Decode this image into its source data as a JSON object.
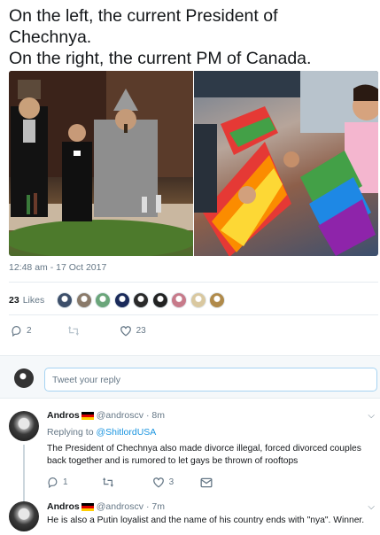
{
  "tweet": {
    "text_lines": [
      "On the left, the current President of",
      "Chechnya.",
      "On the right, the current PM of Canada."
    ],
    "timestamp": "12:48 am - 17 Oct 2017",
    "likes_count": "23",
    "likes_label": "Likes",
    "liker_colors": [
      "#3d4f6a",
      "#8a7a6a",
      "#6aa57a",
      "#1a2a5a",
      "#2a2a2a",
      "#222222",
      "#c77a8a",
      "#d9c8a0",
      "#b08a4a"
    ],
    "actions": {
      "reply_count": "2",
      "retweet_count": "",
      "like_count": "23"
    }
  },
  "reply_box": {
    "placeholder": "Tweet your reply"
  },
  "replies": [
    {
      "name": "Andros",
      "handle": "@androscv",
      "time": "· 8m",
      "replying_prefix": "Replying to ",
      "replying_to": "@ShitlordUSA",
      "body": "The President of Chechnya also made divorce illegal, forced divorced couples back together and is rumored to let gays be thrown of rooftops",
      "reply_count": "1",
      "retweet_count": "",
      "like_count": "3"
    },
    {
      "name": "Andros",
      "handle": "@androscv",
      "time": "· 7m",
      "body": "He is also a Putin loyalist and the name of his country ends with \"nya\". Winner."
    }
  ],
  "colors": {
    "accent": "#1b95e0",
    "secondary_text": "#657786",
    "border": "#e6ecf0"
  }
}
